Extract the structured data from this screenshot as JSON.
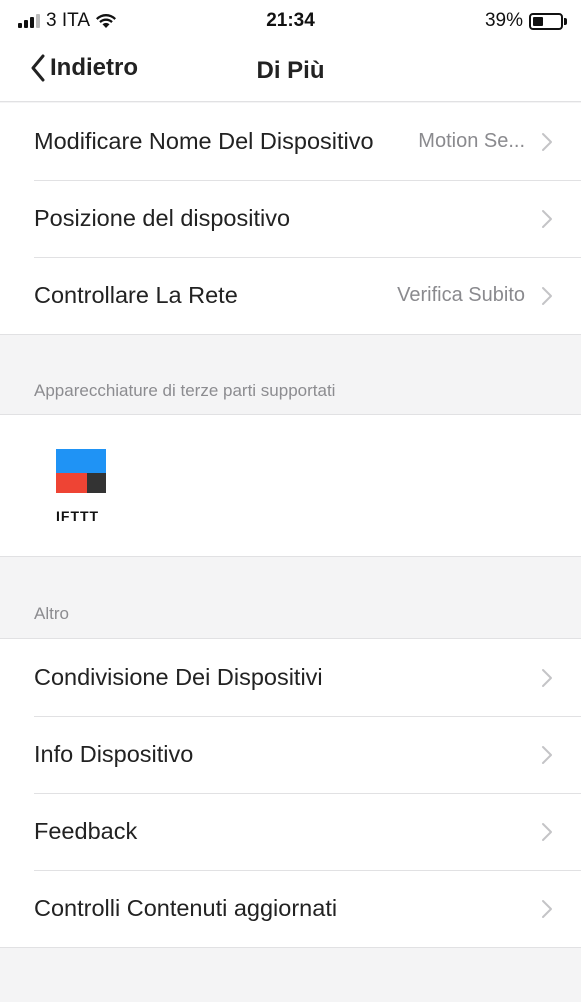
{
  "status_bar": {
    "carrier": "3 ITA",
    "time": "21:34",
    "battery_percent": "39%",
    "battery_level": 0.39,
    "signal_icon": "signal-bars-icon",
    "wifi_icon": "wifi-icon"
  },
  "nav": {
    "back_label": "Indietro",
    "title": "Di Più"
  },
  "device_settings": [
    {
      "label": "Modificare Nome Del Dispositivo",
      "value": "Motion Se..."
    },
    {
      "label": "Posizione del dispositivo",
      "value": ""
    },
    {
      "label": "Controllare La Rete",
      "value": "Verifica Subito"
    }
  ],
  "third_party": {
    "header": "Apparecchiature di terze parti supportati",
    "services": [
      {
        "name": "IFTTT",
        "colors": [
          "#1f93f5",
          "#ee4434",
          "#333333"
        ]
      }
    ]
  },
  "other": {
    "header": "Altro",
    "items": [
      {
        "label": "Condivisione Dei Dispositivi"
      },
      {
        "label": "Info Dispositivo"
      },
      {
        "label": "Feedback"
      },
      {
        "label": "Controlli Contenuti aggiornati"
      }
    ]
  },
  "colors": {
    "background": "#f4f4f5",
    "separator": "#e1e1e3",
    "secondary_text": "#8a8a8e"
  }
}
